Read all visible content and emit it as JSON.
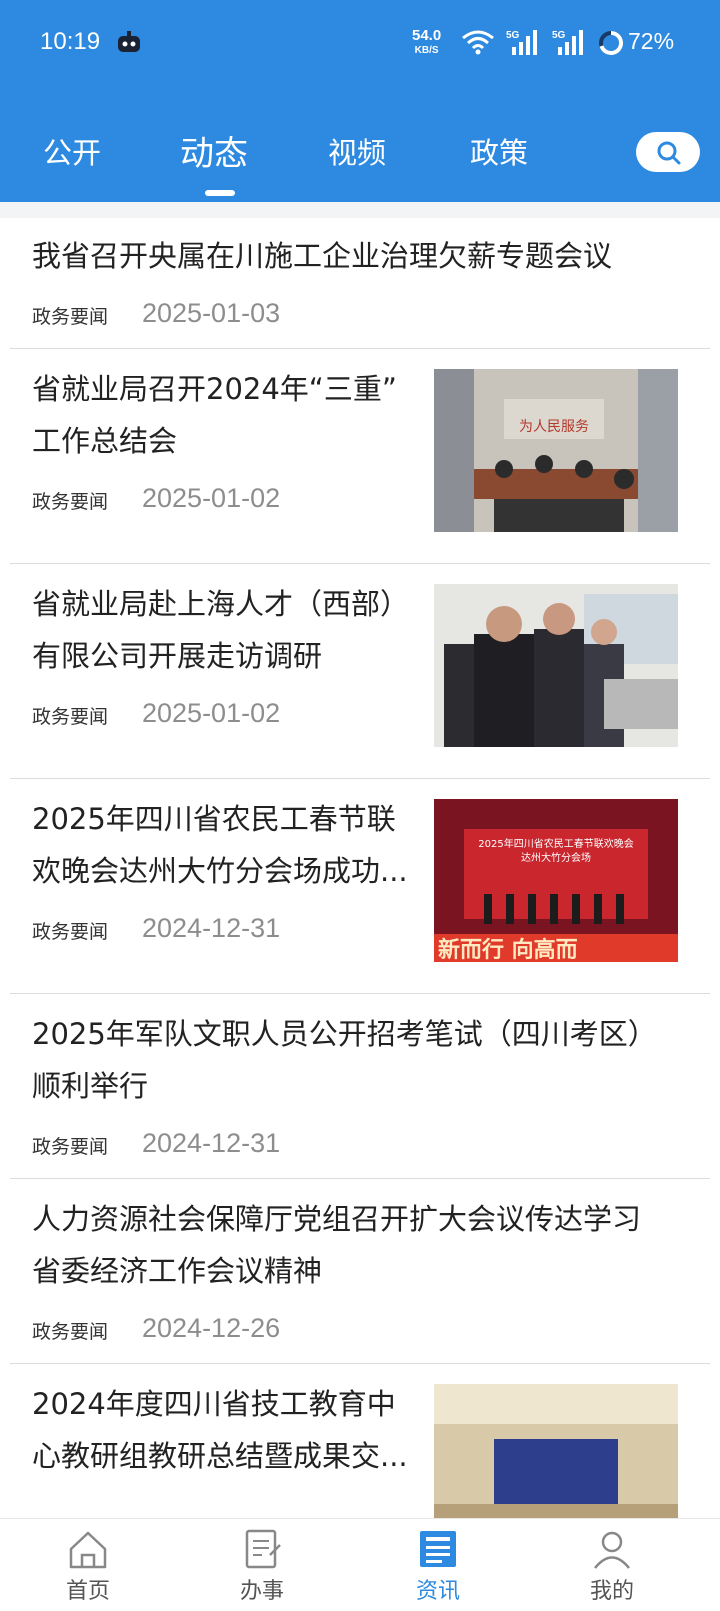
{
  "status_bar": {
    "time": "10:19",
    "net_speed": "54.0",
    "net_unit": "KB/S",
    "battery": "72%"
  },
  "tabs": [
    {
      "label": "公开"
    },
    {
      "label": "动态"
    },
    {
      "label": "视频"
    },
    {
      "label": "政策"
    }
  ],
  "active_tab": "动态",
  "news": [
    {
      "title": "我省召开央属在川施工企业治理欠薪专题会议",
      "category": "政务要闻",
      "date": "2025-01-03"
    },
    {
      "title_lines": [
        "省就业局召开2024年“三重”",
        "工作总结会"
      ],
      "category": "政务要闻",
      "date": "2025-01-02"
    },
    {
      "title_lines": [
        "省就业局赴上海人才（西部）",
        "有限公司开展走访调研"
      ],
      "category": "政务要闻",
      "date": "2025-01-02"
    },
    {
      "title_lines": [
        "2025年四川省农民工春节联",
        "欢晚会达州大竹分会场成功..."
      ],
      "category": "政务要闻",
      "date": "2024-12-31",
      "image_text": [
        "2025年四川省农民工春节联欢晚会",
        "达州大竹分会场",
        "新而行 向高而"
      ]
    },
    {
      "title_lines": [
        "2025年军队文职人员公开招考笔试（四川考区）",
        "顺利举行"
      ],
      "category": "政务要闻",
      "date": "2024-12-31"
    },
    {
      "title_lines": [
        "人力资源社会保障厅党组召开扩大会议传达学习",
        "省委经济工作会议精神"
      ],
      "category": "政务要闻",
      "date": "2024-12-26"
    },
    {
      "title_lines": [
        "2024年度四川省技工教育中",
        "心教研组教研总结暨成果交..."
      ]
    }
  ],
  "bottom_nav": [
    {
      "label": "首页",
      "icon": "home-icon"
    },
    {
      "label": "办事",
      "icon": "document-icon"
    },
    {
      "label": "资讯",
      "icon": "news-icon"
    },
    {
      "label": "我的",
      "icon": "user-icon"
    }
  ],
  "colors": {
    "accent": "#2d8ae0",
    "date": "#8d8d8d"
  }
}
